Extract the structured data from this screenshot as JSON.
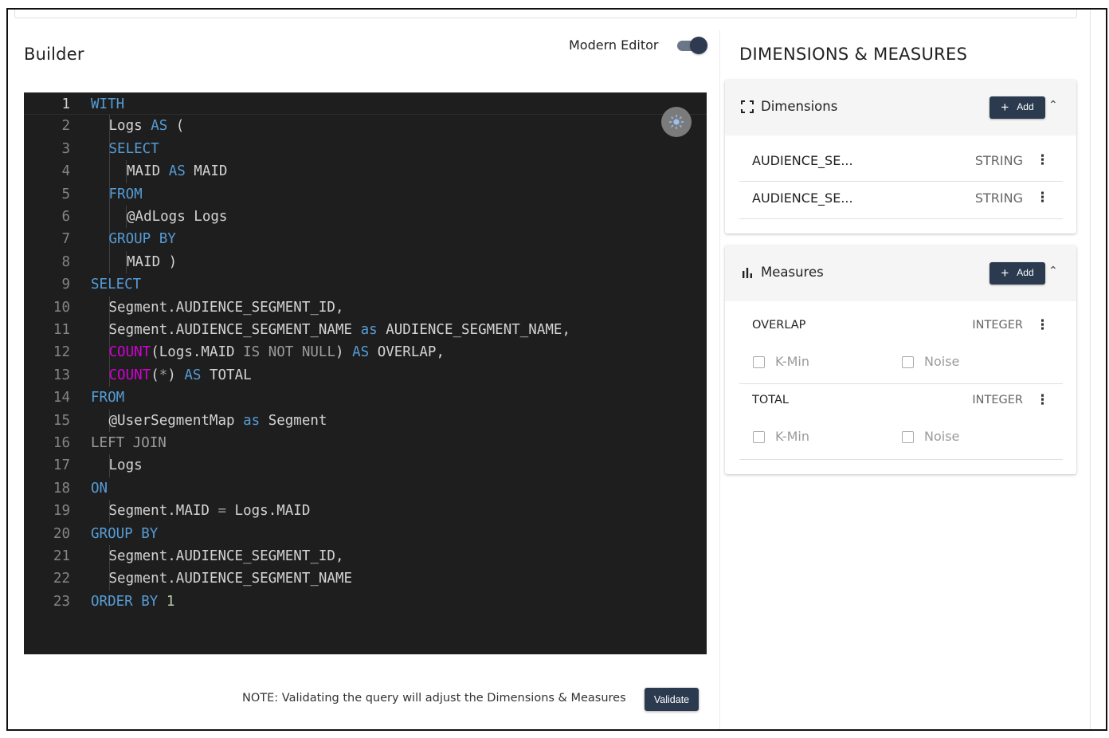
{
  "builder": {
    "title": "Builder",
    "modern_editor_label": "Modern Editor",
    "modern_editor_on": true,
    "note": "NOTE: Validating the query will adjust the Dimensions & Measures",
    "validate_label": "Validate"
  },
  "editor": {
    "lines": [
      {
        "n": "1",
        "indent": 0,
        "tokens": [
          [
            "kw",
            "WITH"
          ]
        ]
      },
      {
        "n": "2",
        "indent": 1,
        "tokens": [
          [
            "t",
            "Logs "
          ],
          [
            "kw",
            "AS"
          ],
          [
            "t",
            " ("
          ]
        ]
      },
      {
        "n": "3",
        "indent": 1,
        "tokens": [
          [
            "kw",
            "SELECT"
          ]
        ]
      },
      {
        "n": "4",
        "indent": 2,
        "tokens": [
          [
            "t",
            "MAID "
          ],
          [
            "kw",
            "AS"
          ],
          [
            "t",
            " MAID"
          ]
        ]
      },
      {
        "n": "5",
        "indent": 1,
        "tokens": [
          [
            "kw",
            "FROM"
          ]
        ]
      },
      {
        "n": "6",
        "indent": 2,
        "tokens": [
          [
            "t",
            "@AdLogs Logs"
          ]
        ]
      },
      {
        "n": "7",
        "indent": 1,
        "tokens": [
          [
            "kw",
            "GROUP BY"
          ]
        ]
      },
      {
        "n": "8",
        "indent": 2,
        "tokens": [
          [
            "t",
            "MAID )"
          ]
        ]
      },
      {
        "n": "9",
        "indent": 0,
        "tokens": [
          [
            "kw",
            "SELECT"
          ]
        ]
      },
      {
        "n": "10",
        "indent": 1,
        "tokens": [
          [
            "t",
            "Segment.AUDIENCE_SEGMENT_ID,"
          ]
        ]
      },
      {
        "n": "11",
        "indent": 1,
        "tokens": [
          [
            "t",
            "Segment.AUDIENCE_SEGMENT_NAME "
          ],
          [
            "kw",
            "as"
          ],
          [
            "t",
            " AUDIENCE_SEGMENT_NAME,"
          ]
        ]
      },
      {
        "n": "12",
        "indent": 1,
        "tokens": [
          [
            "fn",
            "COUNT"
          ],
          [
            "t",
            "(Logs.MAID "
          ],
          [
            "op",
            "IS NOT NULL"
          ],
          [
            "t",
            ") "
          ],
          [
            "kw",
            "AS"
          ],
          [
            "t",
            " OVERLAP,"
          ]
        ]
      },
      {
        "n": "13",
        "indent": 1,
        "tokens": [
          [
            "fn",
            "COUNT"
          ],
          [
            "t",
            "("
          ],
          [
            "op",
            "*"
          ],
          [
            "t",
            ") "
          ],
          [
            "kw",
            "AS"
          ],
          [
            "t",
            " TOTAL"
          ]
        ]
      },
      {
        "n": "14",
        "indent": 0,
        "tokens": [
          [
            "kw",
            "FROM"
          ]
        ]
      },
      {
        "n": "15",
        "indent": 1,
        "tokens": [
          [
            "t",
            "@UserSegmentMap "
          ],
          [
            "kw",
            "as"
          ],
          [
            "t",
            " Segment"
          ]
        ]
      },
      {
        "n": "16",
        "indent": 0,
        "tokens": [
          [
            "op",
            "LEFT JOIN"
          ]
        ]
      },
      {
        "n": "17",
        "indent": 1,
        "tokens": [
          [
            "t",
            "Logs"
          ]
        ]
      },
      {
        "n": "18",
        "indent": 0,
        "tokens": [
          [
            "kw",
            "ON"
          ]
        ]
      },
      {
        "n": "19",
        "indent": 1,
        "tokens": [
          [
            "t",
            "Segment.MAID "
          ],
          [
            "op",
            "="
          ],
          [
            "t",
            " Logs.MAID"
          ]
        ]
      },
      {
        "n": "20",
        "indent": 0,
        "tokens": [
          [
            "kw",
            "GROUP BY"
          ]
        ]
      },
      {
        "n": "21",
        "indent": 1,
        "tokens": [
          [
            "t",
            "Segment.AUDIENCE_SEGMENT_ID,"
          ]
        ]
      },
      {
        "n": "22",
        "indent": 1,
        "tokens": [
          [
            "t",
            "Segment.AUDIENCE_SEGMENT_NAME"
          ]
        ]
      },
      {
        "n": "23",
        "indent": 0,
        "tokens": [
          [
            "kw",
            "ORDER BY"
          ],
          [
            "t",
            " "
          ],
          [
            "num",
            "1"
          ]
        ]
      }
    ],
    "active_line": 1,
    "theme_icon": "sun-icon"
  },
  "panel": {
    "title": "DIMENSIONS & MEASURES",
    "dimensions": {
      "icon": "expand-icon",
      "label": "Dimensions",
      "add_label": "Add",
      "items": [
        {
          "name": "AUDIENCE_SE...",
          "type": "STRING"
        },
        {
          "name": "AUDIENCE_SE...",
          "type": "STRING"
        }
      ]
    },
    "measures": {
      "icon": "bar-chart-icon",
      "label": "Measures",
      "add_label": "Add",
      "items": [
        {
          "name": "OVERLAP",
          "type": "INTEGER",
          "kmin_label": "K-Min",
          "noise_label": "Noise",
          "kmin_checked": false,
          "noise_checked": false
        },
        {
          "name": "TOTAL",
          "type": "INTEGER",
          "kmin_label": "K-Min",
          "noise_label": "Noise",
          "kmin_checked": false,
          "noise_checked": false
        }
      ]
    }
  },
  "colors": {
    "editor_bg": "#1e1e1e",
    "keyword": "#569cd6",
    "function": "#d400d4",
    "button": "#2b3a4f"
  }
}
